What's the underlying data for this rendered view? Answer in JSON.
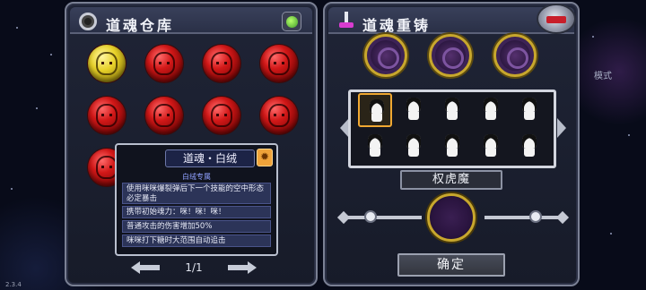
{
  "warehouse": {
    "title": "道魂仓库",
    "orbs": [
      {
        "color": "gold"
      },
      {
        "color": "red"
      },
      {
        "color": "red"
      },
      {
        "color": "red"
      },
      {
        "color": "red"
      },
      {
        "color": "red"
      },
      {
        "color": "red"
      },
      {
        "color": "red"
      },
      {
        "color": "red"
      }
    ]
  },
  "tooltip": {
    "title": "道魂・白绒",
    "subtitle": "白绒专属",
    "lines": [
      "使用咪咪爆裂弹后下一个技能的空中形态必定暴击",
      "携带初始魂力：咪！咪！咪！",
      "普通攻击的伤害增加50%",
      "咪咪打下糖时大范围自动追击"
    ]
  },
  "pager": {
    "current_page": "1/1"
  },
  "reforge": {
    "title": "道魂重铸",
    "characters_count": 10,
    "selected_index": 0,
    "selected_name": "权虎魔",
    "confirm_label": "确定"
  },
  "background": {
    "mode_label": "模式",
    "version": "2.3.4"
  },
  "colors": {
    "orb_red": "#d21818",
    "orb_gold": "#e8d22a",
    "slot_gold": "#c8a72d",
    "selection": "#f0a832"
  }
}
